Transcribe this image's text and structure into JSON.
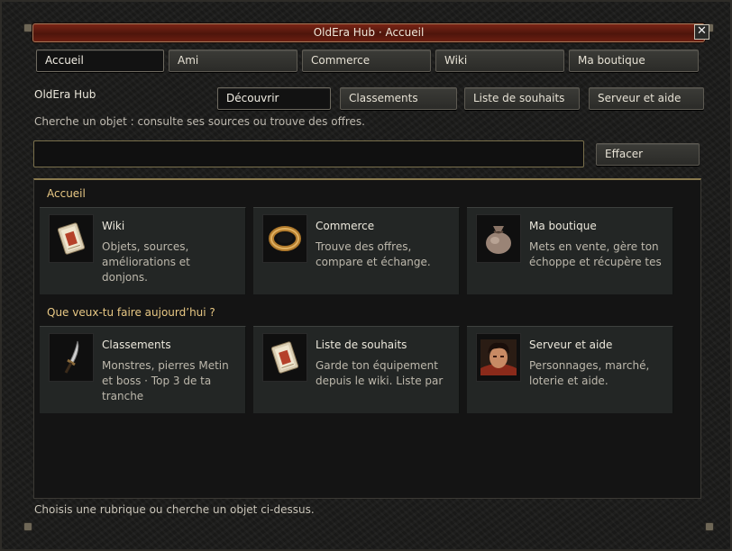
{
  "window": {
    "title": "OldEra Hub · Accueil",
    "close_glyph": "✕"
  },
  "main_tabs": [
    "Accueil",
    "Ami",
    "Commerce",
    "Wiki",
    "Ma boutique"
  ],
  "hub": {
    "label": "OldEra Hub",
    "subtabs": [
      "Découvrir",
      "Classements",
      "Liste de souhaits",
      "Serveur et aide"
    ],
    "hint": "Cherche un objet : consulte ses sources ou trouve des offres."
  },
  "search": {
    "value": "",
    "placeholder": "",
    "clear_label": "Effacer"
  },
  "sections": [
    {
      "title": "Accueil",
      "cards": [
        {
          "title": "Wiki",
          "desc": "Objets, sources, améliorations et donjons.",
          "icon": "book-icon"
        },
        {
          "title": "Commerce",
          "desc": "Trouve des offres, compare et échange.",
          "icon": "ring-icon"
        },
        {
          "title": "Ma boutique",
          "desc": "Mets en vente, gère ton échoppe et récupère tes",
          "icon": "bag-icon"
        }
      ]
    },
    {
      "title": "Que veux-tu faire aujourd’hui ?",
      "cards": [
        {
          "title": "Classements",
          "desc": "Monstres, pierres Metin et boss · Top 3 de ta tranche",
          "icon": "sword-icon"
        },
        {
          "title": "Liste de souhaits",
          "desc": "Garde ton équipement depuis le wiki. Liste par",
          "icon": "book-icon"
        },
        {
          "title": "Serveur et aide",
          "desc": "Personnages, marché, loterie et aide.",
          "icon": "portrait-icon"
        }
      ]
    }
  ],
  "footer": "Choisis une rubrique ou cherche un objet ci-dessus.",
  "colors": {
    "accent_gold": "#e8c884",
    "title_red": "#6b1e11"
  }
}
